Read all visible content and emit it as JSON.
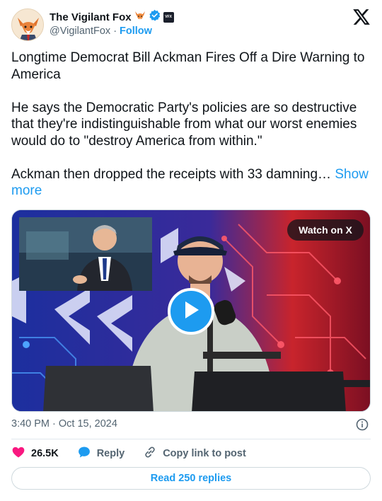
{
  "author": {
    "display_name": "The Vigilant Fox",
    "handle": "@VigilantFox",
    "separator": "·",
    "follow_label": "Follow",
    "badge_text": "VFX"
  },
  "tweet": {
    "paragraph_1": "Longtime Democrat Bill Ackman Fires Off a Dire Warning to America",
    "paragraph_2": "He says the Democratic Party's policies are so destructive that they're indistinguishable from what our worst enemies would do to \"destroy America from within.\"",
    "paragraph_3": "Ackman then dropped the receipts with 33 damning…",
    "show_more_label": "Show more"
  },
  "media": {
    "watch_label": "Watch on X"
  },
  "meta": {
    "timestamp": "3:40 PM · Oct 15, 2024"
  },
  "actions": {
    "likes_count": "26.5K",
    "reply_label": "Reply",
    "copy_link_label": "Copy link to post"
  },
  "read_replies_label": "Read 250 replies",
  "colors": {
    "accent": "#1d9bf0",
    "like": "#f91880",
    "text": "#0f1419",
    "muted": "#536471"
  }
}
